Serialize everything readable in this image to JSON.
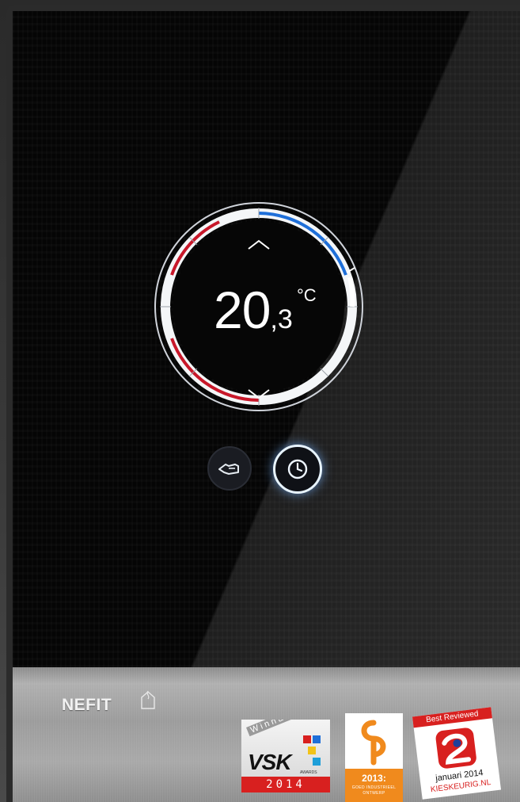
{
  "thermostat": {
    "temperature_integer": "20",
    "temperature_decimal": ",3",
    "unit": "°C",
    "up_icon": "chevron-up-icon",
    "down_icon": "chevron-down-icon"
  },
  "controls": {
    "manual_icon": "hand-icon",
    "schedule_icon": "clock-icon"
  },
  "brand": {
    "name": "NEFIT",
    "mark_icon": "flame-house-icon"
  },
  "awards": {
    "vsk": {
      "winner": "Winnaar",
      "logo": "VSK",
      "subtitle": "AWARDS",
      "year": "2014"
    },
    "goed_industrieel_ontwerp": {
      "year": "2013:",
      "line1": "GOED INDUSTRIEEL",
      "line2": "ONTWERP"
    },
    "kieskeurig": {
      "badge": "Best Reviewed",
      "date": "januari 2014",
      "site": "KIESKEURIG.NL"
    }
  },
  "colors": {
    "ring_heat": "#c8182a",
    "ring_cool": "#1e6fd9",
    "award_red": "#d8201f",
    "award_orange": "#f08a1d"
  }
}
